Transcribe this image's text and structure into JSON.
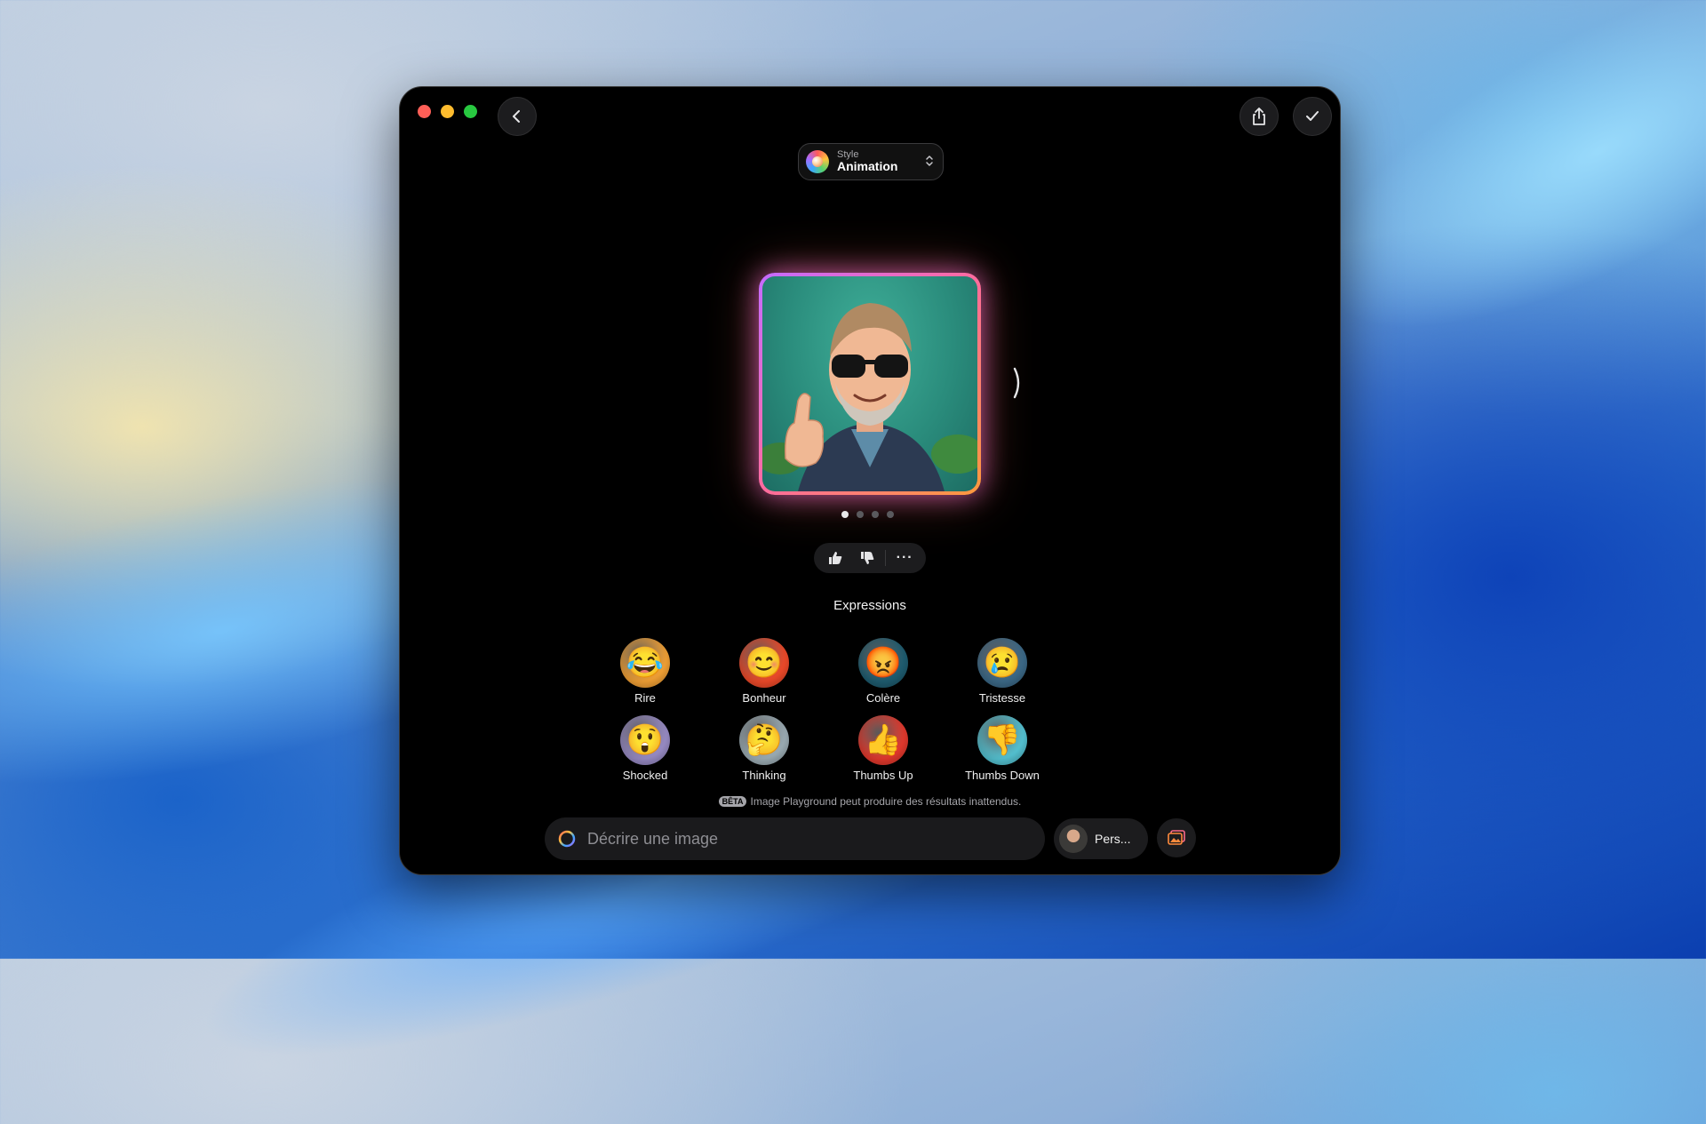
{
  "header": {
    "back_icon": "chevron-left-icon",
    "share_icon": "share-icon",
    "done_icon": "checkmark-icon"
  },
  "style_picker": {
    "label": "Style",
    "value": "Animation",
    "icon": "style-orb-icon"
  },
  "preview": {
    "pages_total": 4,
    "current_page": 1,
    "next_icon": "chevron-right-icon"
  },
  "feedback": {
    "thumbs_up_icon": "thumbs-up-icon",
    "thumbs_down_icon": "thumbs-down-icon",
    "more_label": "···"
  },
  "expressions": {
    "title": "Expressions",
    "items": [
      {
        "label": "Rire",
        "emoji": "😂",
        "color": "#f7a436"
      },
      {
        "label": "Bonheur",
        "emoji": "😊",
        "color": "#f24b2a"
      },
      {
        "label": "Colère",
        "emoji": "😡",
        "color": "#1f5e72"
      },
      {
        "label": "Tristesse",
        "emoji": "😢",
        "color": "#3d6b8a"
      },
      {
        "label": "Shocked",
        "emoji": "😲",
        "color": "#9b8ec9"
      },
      {
        "label": "Thinking",
        "emoji": "🤔",
        "color": "#9fb0b8"
      },
      {
        "label": "Thumbs Up",
        "emoji": "👍",
        "color": "#e83a2e"
      },
      {
        "label": "Thumbs Down",
        "emoji": "👎",
        "color": "#56c6d6"
      }
    ]
  },
  "disclaimer": {
    "badge": "BÊTA",
    "text": "Image Playground peut produire des résultats inattendus."
  },
  "prompt": {
    "placeholder": "Décrire une image",
    "value": ""
  },
  "person": {
    "label": "Pers..."
  },
  "colors": {
    "window_bg": "#000000",
    "glow_start": "#c46bff",
    "glow_end": "#ff9a3c"
  }
}
